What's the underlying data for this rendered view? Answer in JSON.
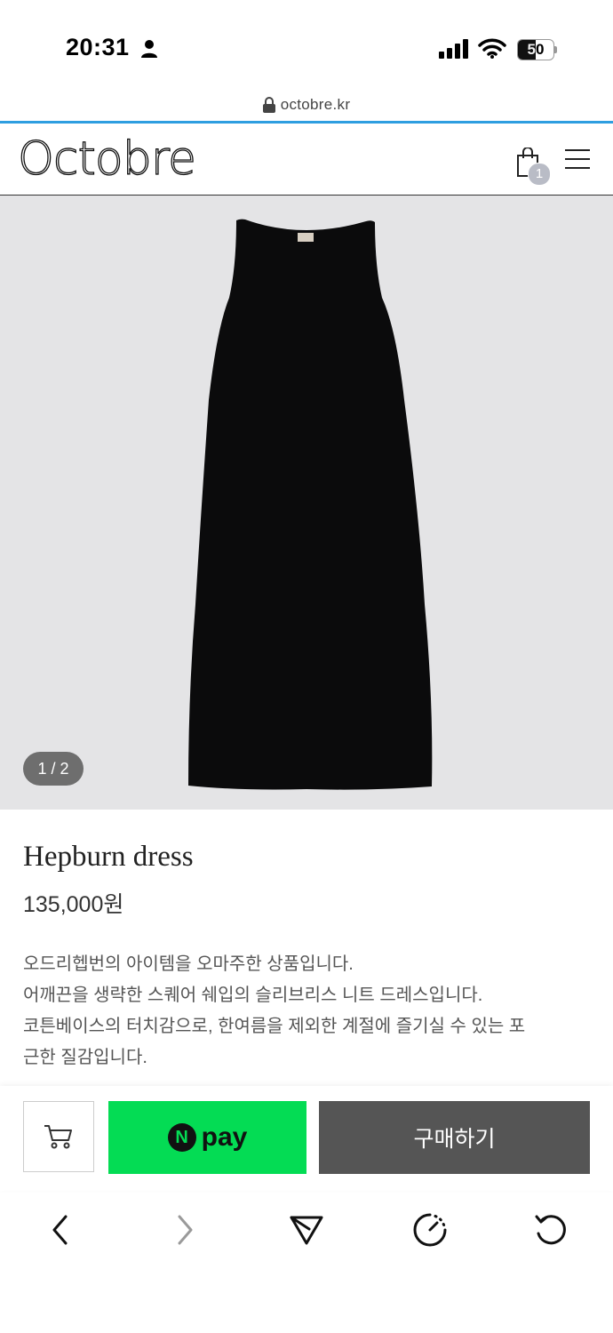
{
  "status_bar": {
    "time": "20:31",
    "battery_level": "50",
    "battery_fraction": 0.5
  },
  "browser": {
    "url": "octobre.kr"
  },
  "header": {
    "logo": "Octobre",
    "cart_count": "1"
  },
  "gallery": {
    "counter": "1 / 2"
  },
  "product": {
    "name": "Hepburn dress",
    "price": "135,000원",
    "description": [
      "오드리헵번의 아이템을 오마주한 상품입니다.",
      "어깨끈을 생략한 스퀘어 쉐입의 슬리브리스 니트 드레스입니다.",
      "코튼베이스의 터치감으로, 한여름을 제외한 계절에 즐기실 수 있는 포",
      "근한 질감입니다."
    ]
  },
  "purchase_bar": {
    "npay_mark": "N",
    "npay_label": "pay",
    "buy_label": "구매하기"
  },
  "colors": {
    "npay_green": "#04dc54",
    "buy_button": "#555555",
    "progress": "#2e9ee0",
    "image_bg": "#e4e4e6"
  }
}
